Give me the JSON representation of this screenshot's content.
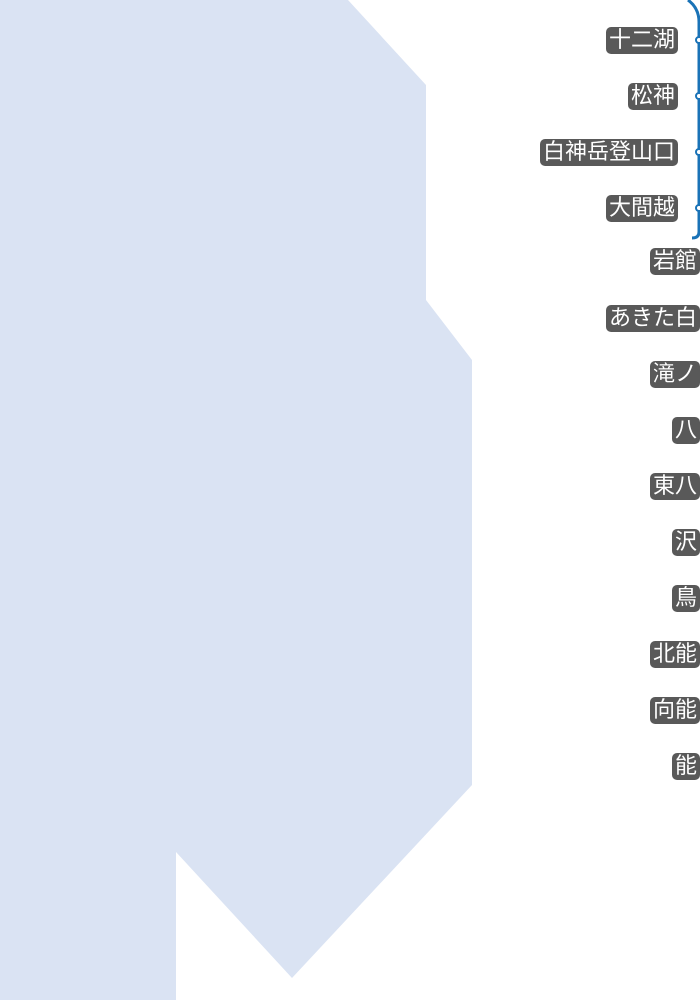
{
  "map": {
    "region_fill": "#dae3f3",
    "line_color": "#1a73b7",
    "label_background": "#595959",
    "label_text_color": "#ffffff",
    "stations": [
      {
        "name": "十二湖",
        "on_visible_line": true
      },
      {
        "name": "松神",
        "on_visible_line": true
      },
      {
        "name": "白神岳登山口",
        "on_visible_line": true
      },
      {
        "name": "大間越",
        "on_visible_line": true
      },
      {
        "name": "岩館",
        "on_visible_line": false
      },
      {
        "name": "あきた白",
        "on_visible_line": false
      },
      {
        "name": "滝ノ",
        "on_visible_line": false
      },
      {
        "name": "八",
        "on_visible_line": false
      },
      {
        "name": "東八",
        "on_visible_line": false
      },
      {
        "name": "沢",
        "on_visible_line": false
      },
      {
        "name": "鳥",
        "on_visible_line": false
      },
      {
        "name": "北能",
        "on_visible_line": false
      },
      {
        "name": "向能",
        "on_visible_line": false
      },
      {
        "name": "能",
        "on_visible_line": false
      }
    ]
  }
}
